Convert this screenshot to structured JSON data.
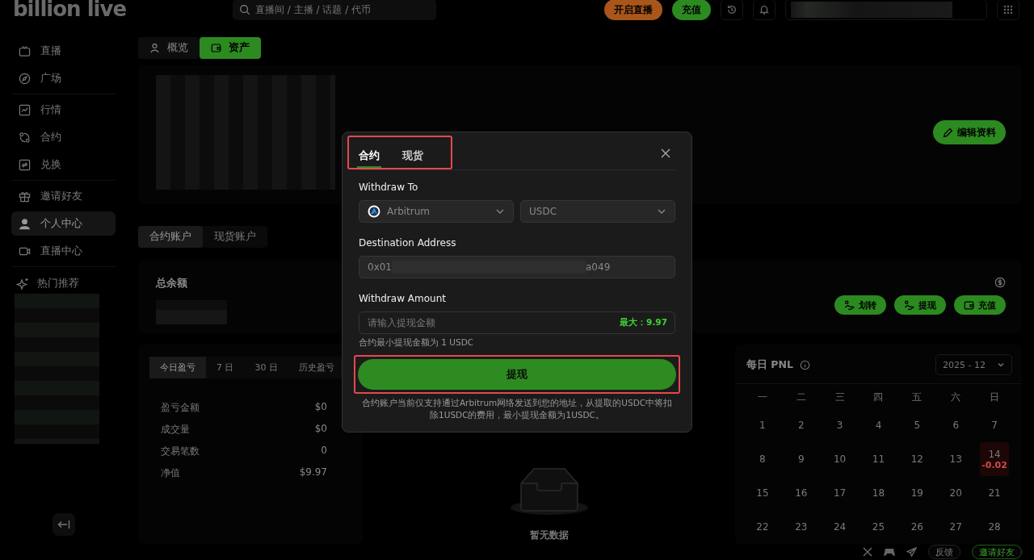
{
  "topbar": {
    "logo": "billion live",
    "search": {
      "placeholder": "直播间 / 主播 / 话题 / 代币"
    },
    "go_live": "开启直播",
    "deposit": "充值"
  },
  "sidebar": {
    "groups": [
      [
        {
          "label": "直播",
          "selected": false
        },
        {
          "label": "广场",
          "selected": false
        }
      ],
      [
        {
          "label": "行情",
          "selected": false
        },
        {
          "label": "合约",
          "selected": false
        },
        {
          "label": "兑换",
          "selected": false
        }
      ],
      [
        {
          "label": "邀请好友",
          "selected": false
        },
        {
          "label": "个人中心",
          "selected": true
        },
        {
          "label": "直播中心",
          "selected": false
        }
      ]
    ],
    "hot_title": "热门推荐"
  },
  "page_tabs": [
    {
      "label": "概览",
      "selected": false
    },
    {
      "label": "资产",
      "selected": true
    }
  ],
  "edit_profile": "编辑资料",
  "account_tabs": [
    {
      "label": "合约账户",
      "selected": true
    },
    {
      "label": "现货账户",
      "selected": false
    }
  ],
  "balance": {
    "label": "总余额",
    "actions": [
      "划转",
      "提现",
      "充值"
    ]
  },
  "pnl_tabs": [
    {
      "label": "今日盈亏",
      "selected": true
    },
    {
      "label": "7 日",
      "selected": false
    },
    {
      "label": "30 日",
      "selected": false
    },
    {
      "label": "历史盈亏",
      "selected": false
    }
  ],
  "stats": [
    {
      "label": "盈亏金额",
      "value": "$0"
    },
    {
      "label": "成交量",
      "value": "$0"
    },
    {
      "label": "交易笔数",
      "value": "0"
    },
    {
      "label": "净值",
      "value": "$9.97"
    }
  ],
  "empty_text": "暂无数据",
  "calendar": {
    "title": "每日 PNL",
    "month": "2025 - 12",
    "weekdays": [
      "一",
      "二",
      "三",
      "四",
      "五",
      "六",
      "日"
    ],
    "weeks": [
      [
        {
          "day": "1"
        },
        {
          "day": "2"
        },
        {
          "day": "3"
        },
        {
          "day": "4"
        },
        {
          "day": "5"
        },
        {
          "day": "6"
        },
        {
          "day": "7"
        }
      ],
      [
        {
          "day": "8"
        },
        {
          "day": "9"
        },
        {
          "day": "10"
        },
        {
          "day": "11"
        },
        {
          "day": "12"
        },
        {
          "day": "13"
        },
        {
          "day": "14",
          "pnl": "-0.02"
        }
      ],
      [
        {
          "day": "15"
        },
        {
          "day": "16"
        },
        {
          "day": "17"
        },
        {
          "day": "18"
        },
        {
          "day": "19"
        },
        {
          "day": "20"
        },
        {
          "day": "21"
        }
      ],
      [
        {
          "day": "22"
        },
        {
          "day": "23"
        },
        {
          "day": "24"
        },
        {
          "day": "25"
        },
        {
          "day": "26"
        },
        {
          "day": "27"
        },
        {
          "day": "28"
        }
      ]
    ]
  },
  "footer": {
    "feedback": "反馈",
    "invite": "邀请好友"
  },
  "modal": {
    "tabs": [
      {
        "label": "合约",
        "selected": true
      },
      {
        "label": "现货",
        "selected": false
      }
    ],
    "withdraw_to_label": "Withdraw To",
    "network": "Arbitrum",
    "token": "USDC",
    "address_label": "Destination Address",
    "address_start": "0x01",
    "address_end": "a049",
    "amount_label": "Withdraw Amount",
    "amount_placeholder": "请输入提现金额",
    "max": "最大：9.97",
    "min_hint": "合约最小提现金额为 1 USDC",
    "submit": "提现",
    "note": "合约账户当前仅支持通过Arbitrum网络发送到您的地址，从提取的USDC中将扣除1USDC的费用，最小提现金额为1USDC。"
  }
}
